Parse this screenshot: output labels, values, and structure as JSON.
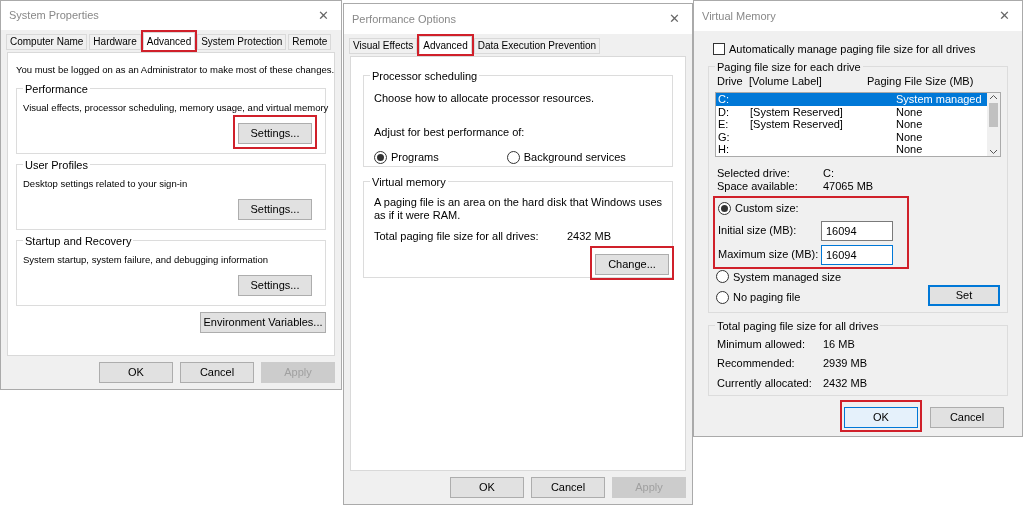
{
  "system_properties": {
    "title": "System Properties",
    "close": "✕",
    "tabs": [
      {
        "label": "Computer Name",
        "selected": false,
        "highlighted": false
      },
      {
        "label": "Hardware",
        "selected": false,
        "highlighted": false
      },
      {
        "label": "Advanced",
        "selected": true,
        "highlighted": true
      },
      {
        "label": "System Protection",
        "selected": false,
        "highlighted": false
      },
      {
        "label": "Remote",
        "selected": false,
        "highlighted": false
      }
    ],
    "notice": "You must be logged on as an Administrator to make most of these changes.",
    "groups": [
      {
        "title": "Performance",
        "text": "Visual effects, processor scheduling, memory usage, and virtual memory",
        "button": {
          "label": "Settings...",
          "highlighted": true
        }
      },
      {
        "title": "User Profiles",
        "text": "Desktop settings related to your sign-in",
        "button": {
          "label": "Settings...",
          "highlighted": false
        }
      },
      {
        "title": "Startup and Recovery",
        "text": "System startup, system failure, and debugging information",
        "button": {
          "label": "Settings...",
          "highlighted": false
        }
      }
    ],
    "environment_button": "Environment Variables...",
    "buttons": [
      {
        "label": "OK",
        "disabled": false
      },
      {
        "label": "Cancel",
        "disabled": false
      },
      {
        "label": "Apply",
        "disabled": true
      }
    ]
  },
  "performance_options": {
    "title": "Performance Options",
    "close": "✕",
    "tabs": [
      {
        "label": "Visual Effects",
        "selected": false,
        "highlighted": false
      },
      {
        "label": "Advanced",
        "selected": true,
        "highlighted": true
      },
      {
        "label": "Data Execution Prevention",
        "selected": false,
        "highlighted": false
      }
    ],
    "processor_scheduling": {
      "title": "Processor scheduling",
      "text": "Choose how to allocate processor resources.",
      "adjust_label": "Adjust for best performance of:",
      "options": [
        {
          "label": "Programs",
          "selected": true
        },
        {
          "label": "Background services",
          "selected": false
        }
      ]
    },
    "virtual_memory": {
      "title": "Virtual memory",
      "text": "A paging file is an area on the hard disk that Windows uses as if it were RAM.",
      "total_label": "Total paging file size for all drives:",
      "total_value": "2432 MB",
      "button": {
        "label": "Change...",
        "highlighted": true
      }
    },
    "buttons": [
      {
        "label": "OK",
        "disabled": false
      },
      {
        "label": "Cancel",
        "disabled": false
      },
      {
        "label": "Apply",
        "disabled": true
      }
    ]
  },
  "virtual_memory": {
    "title": "Virtual Memory",
    "close": "✕",
    "auto_manage": {
      "label": "Automatically manage paging file size for all drives",
      "checked": false
    },
    "drives_group": {
      "title": "Paging file size for each drive",
      "columns": [
        "Drive",
        "[Volume Label]",
        "Paging File Size (MB)"
      ],
      "rows": [
        {
          "drive": "C:",
          "size": "System managed",
          "selected": true
        },
        {
          "drive": "D:",
          "label": "[System Reserved]",
          "size": "None",
          "selected": false
        },
        {
          "drive": "E:",
          "label": "[System Reserved]",
          "size": "None",
          "selected": false
        },
        {
          "drive": "G:",
          "size": "None",
          "selected": false
        },
        {
          "drive": "H:",
          "size": "None",
          "selected": false
        }
      ],
      "selected_drive_label": "Selected drive:",
      "selected_drive": "C:",
      "space_label": "Space available:",
      "space_value": "47065 MB",
      "custom": {
        "label": "Custom size:",
        "selected": true,
        "highlighted": true,
        "initial_label": "Initial size (MB):",
        "initial_value": "16094",
        "maximum_label": "Maximum size (MB):",
        "maximum_value": "16094"
      },
      "options": [
        {
          "label": "System managed size",
          "selected": false
        },
        {
          "label": "No paging file",
          "selected": false
        }
      ],
      "set_button": "Set"
    },
    "totals": {
      "title": "Total paging file size for all drives",
      "rows": [
        {
          "label": "Minimum allowed:",
          "value": "16 MB"
        },
        {
          "label": "Recommended:",
          "value": "2939 MB"
        },
        {
          "label": "Currently allocated:",
          "value": "2432 MB"
        }
      ]
    },
    "buttons": [
      {
        "label": "OK",
        "highlighted": true
      },
      {
        "label": "Cancel",
        "highlighted": false
      }
    ]
  }
}
